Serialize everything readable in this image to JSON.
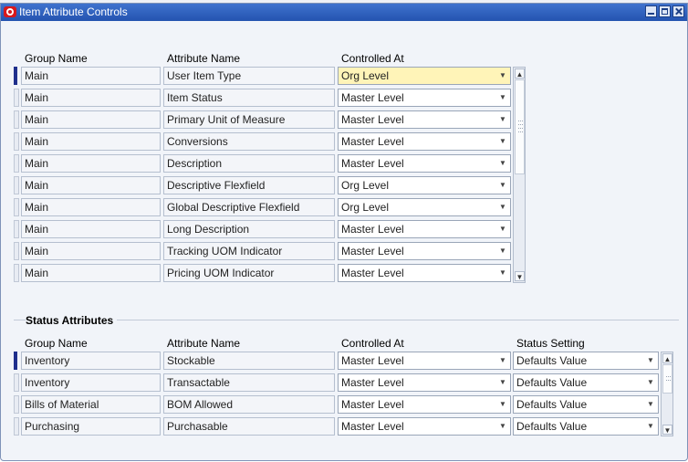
{
  "window": {
    "title": "Item Attribute Controls"
  },
  "table1": {
    "headers": [
      "Group Name",
      "Attribute Name",
      "Controlled At"
    ],
    "rows": [
      {
        "group": "Main",
        "attribute": "User Item Type",
        "controlled": "Org Level"
      },
      {
        "group": "Main",
        "attribute": "Item Status",
        "controlled": "Master Level"
      },
      {
        "group": "Main",
        "attribute": "Primary Unit of Measure",
        "controlled": "Master Level"
      },
      {
        "group": "Main",
        "attribute": "Conversions",
        "controlled": "Master Level"
      },
      {
        "group": "Main",
        "attribute": "Description",
        "controlled": "Master Level"
      },
      {
        "group": "Main",
        "attribute": "Descriptive Flexfield",
        "controlled": "Org Level"
      },
      {
        "group": "Main",
        "attribute": "Global Descriptive Flexfield",
        "controlled": "Org Level"
      },
      {
        "group": "Main",
        "attribute": "Long Description",
        "controlled": "Master Level"
      },
      {
        "group": "Main",
        "attribute": "Tracking UOM Indicator",
        "controlled": "Master Level"
      },
      {
        "group": "Main",
        "attribute": "Pricing UOM Indicator",
        "controlled": "Master Level"
      }
    ]
  },
  "status_section": {
    "title": "Status Attributes"
  },
  "table2": {
    "headers": [
      "Group Name",
      "Attribute Name",
      "Controlled At",
      "Status Setting"
    ],
    "rows": [
      {
        "group": "Inventory",
        "attribute": "Stockable",
        "controlled": "Master Level",
        "status": "Defaults Value"
      },
      {
        "group": "Inventory",
        "attribute": "Transactable",
        "controlled": "Master Level",
        "status": "Defaults Value"
      },
      {
        "group": "Bills of Material",
        "attribute": "BOM Allowed",
        "controlled": "Master Level",
        "status": "Defaults Value"
      },
      {
        "group": "Purchasing",
        "attribute": "Purchasable",
        "controlled": "Master Level",
        "status": "Defaults Value"
      }
    ]
  },
  "icons": {
    "window_logo": "oracle-logo-icon",
    "minimize": "minimize-icon",
    "maximize": "maximize-icon",
    "close": "close-icon",
    "dropdown": "chevron-down-icon",
    "scroll_up": "scroll-up-arrow-icon",
    "scroll_down": "scroll-down-arrow-icon"
  },
  "colors": {
    "title_bar": "#2d5dbf",
    "window_bg": "#f1f4f9",
    "active_field": "#fff4b8",
    "record_indicator": "#1f2f8c"
  }
}
